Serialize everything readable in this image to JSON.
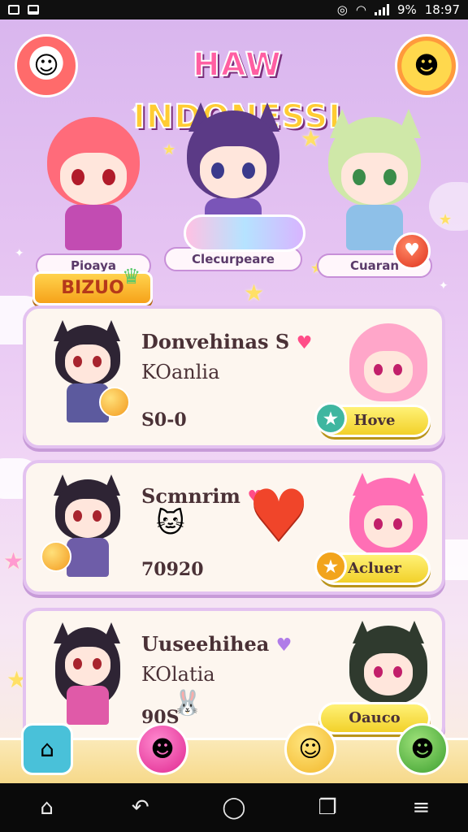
{
  "status_bar": {
    "battery": "9%",
    "time": "18:97"
  },
  "header": {
    "title_part1": "HAW",
    "title_part2": "INDONESSI"
  },
  "heroes": [
    {
      "name": "Pioaya"
    },
    {
      "name": "Clecurpeare"
    },
    {
      "name": "Cuaran"
    }
  ],
  "section": {
    "label": "BIZUO"
  },
  "cards": [
    {
      "name": "Donvehinas S",
      "sub": "KOanlia",
      "score": "S0-0",
      "button": "Hove"
    },
    {
      "name": "Scmnrim",
      "sub": "",
      "score": "70920",
      "button": "Acluer"
    },
    {
      "name": "Uuseehihea",
      "sub": "KOlatia",
      "score": "90S",
      "button": "Oauco"
    }
  ],
  "colors": {
    "bg_top": "#d9b6ee",
    "accent_pink": "#ff5fa2",
    "accent_yellow": "#ffcc33",
    "button_yellow": "#f2d12a",
    "heart_red": "#f0452a"
  },
  "icons": {
    "nav_home": "⌂",
    "nav_back": "↶",
    "nav_recents_home": "◯",
    "nav_overview": "❐",
    "nav_menu": "≡"
  }
}
